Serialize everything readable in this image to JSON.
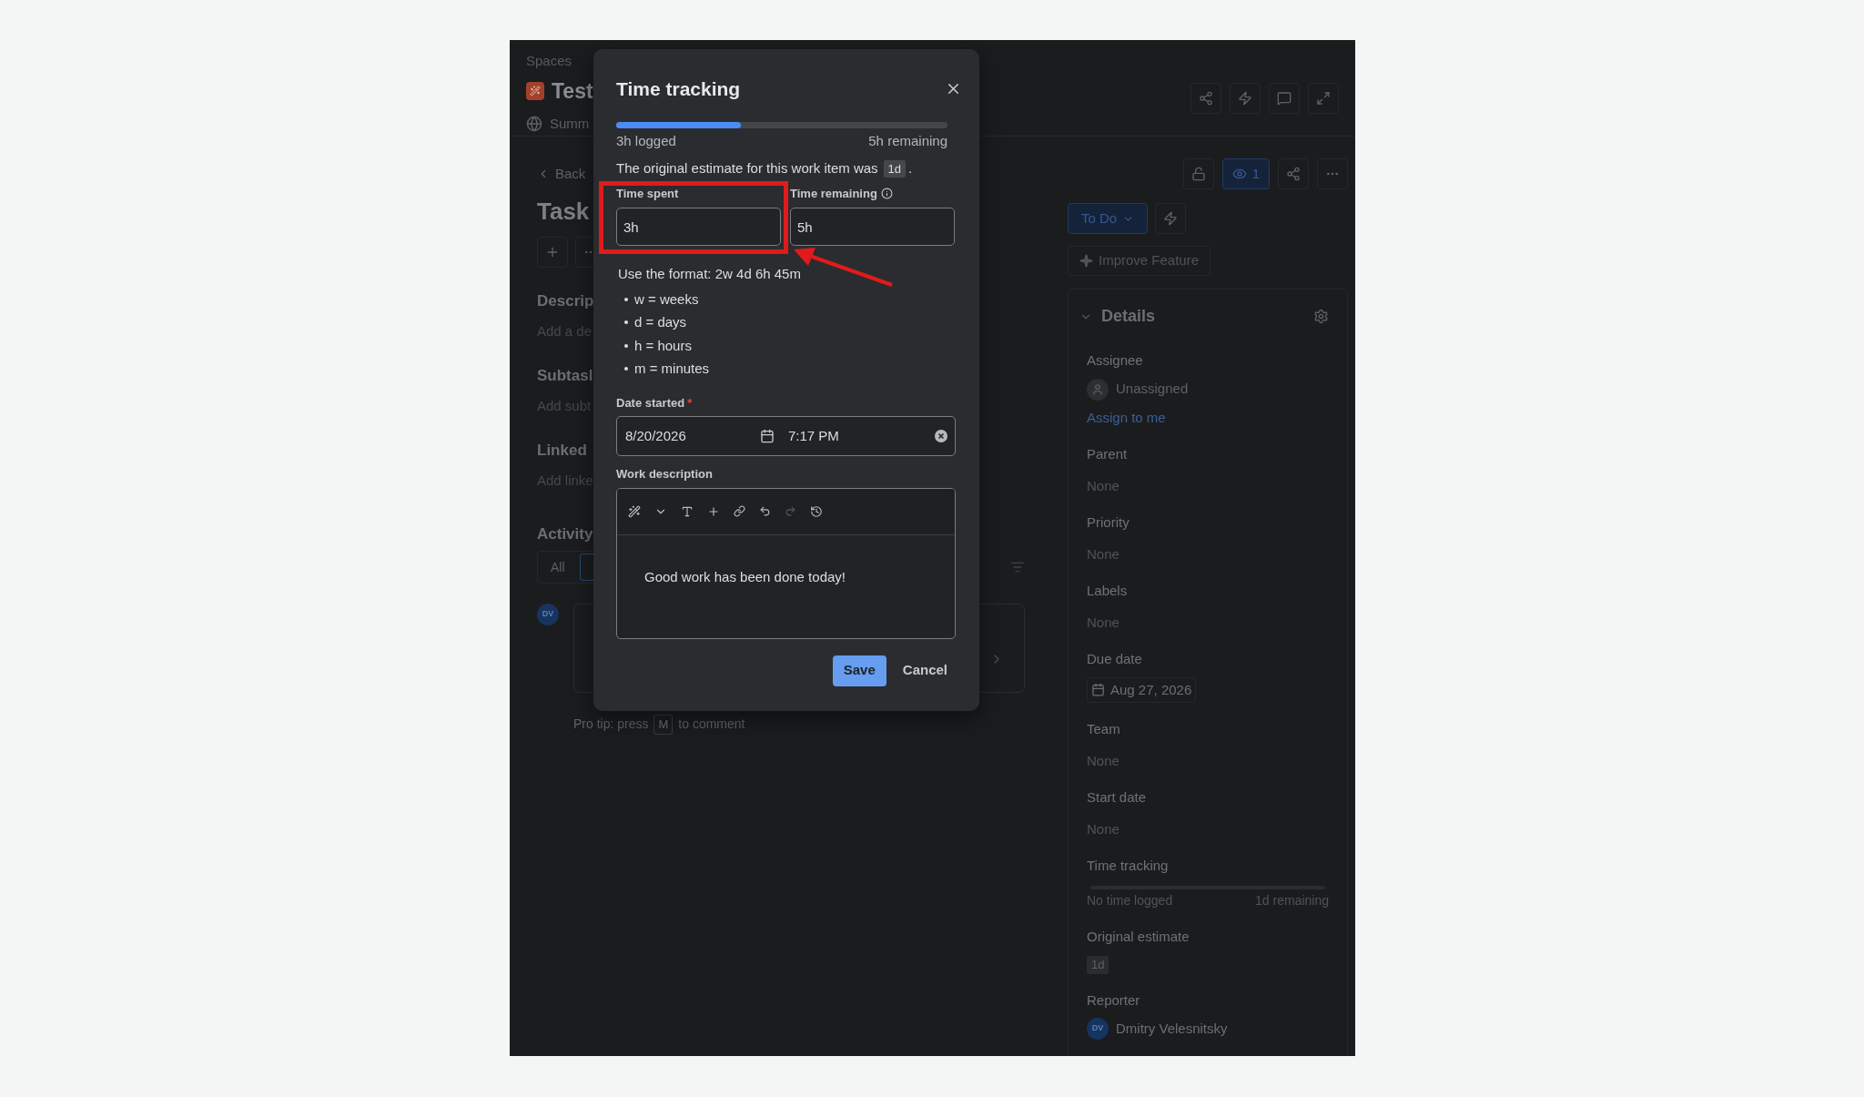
{
  "header": {
    "breadcrumb": "Spaces",
    "project": "Test",
    "tab": "Summ"
  },
  "main": {
    "back": "Back",
    "title": "Task",
    "sections": [
      {
        "heading": "Descrip",
        "placeholder": "Add a de"
      },
      {
        "heading": "Subtasl",
        "placeholder": "Add subt"
      },
      {
        "heading": "Linked",
        "placeholder": "Add linke"
      }
    ],
    "activity": {
      "heading": "Activity",
      "tabs": [
        {
          "label": "All",
          "selected": false
        },
        {
          "selected": true
        }
      ]
    },
    "comment": {
      "avatar": "DV",
      "tip_lead": "Pro tip: press",
      "tip_key": "M",
      "tip_tail": "to comment"
    }
  },
  "side": {
    "watchers": "1",
    "status": "To Do",
    "improve": "Improve Feature",
    "details_title": "Details",
    "fields": [
      {
        "kind": "user",
        "label": "Assignee",
        "value": "Unassigned",
        "link": "Assign to me"
      },
      {
        "kind": "text",
        "label": "Parent",
        "value": "None"
      },
      {
        "kind": "text",
        "label": "Priority",
        "value": "None"
      },
      {
        "kind": "text",
        "label": "Labels",
        "value": "None"
      },
      {
        "kind": "date",
        "label": "Due date",
        "value": "Aug 27, 2026"
      },
      {
        "kind": "text",
        "label": "Team",
        "value": "None"
      },
      {
        "kind": "text",
        "label": "Start date",
        "value": "None"
      },
      {
        "kind": "tracking",
        "label": "Time tracking",
        "level": 0,
        "logged": "No time logged",
        "remaining": "1d remaining"
      },
      {
        "kind": "chip",
        "label": "Original estimate",
        "value": "1d"
      },
      {
        "kind": "person",
        "label": "Reporter",
        "avatar": "DV",
        "value": "Dmitry Velesnitsky"
      }
    ]
  },
  "dialog": {
    "title": "Time tracking",
    "progress": {
      "level": 0.375,
      "logged": "3h logged",
      "remaining": "5h remaining"
    },
    "estimate_text": "The original estimate for this work item was",
    "estimate": "1d",
    "estimate_end": ".",
    "time_spent": {
      "label": "Time spent",
      "value": "3h"
    },
    "time_remaining": {
      "label": "Time remaining",
      "value": "5h"
    },
    "format_hint": "Use the format: 2w 4d 6h 45m",
    "units": [
      "w = weeks",
      "d = days",
      "h = hours",
      "m = minutes"
    ],
    "date_started": {
      "label": "Date started",
      "required_mark": "*",
      "date": "8/20/2026",
      "time": "7:17 PM"
    },
    "work_description": {
      "label": "Work description",
      "text": "Good work has been done today!"
    },
    "buttons": {
      "save": "Save",
      "cancel": "Cancel"
    }
  }
}
